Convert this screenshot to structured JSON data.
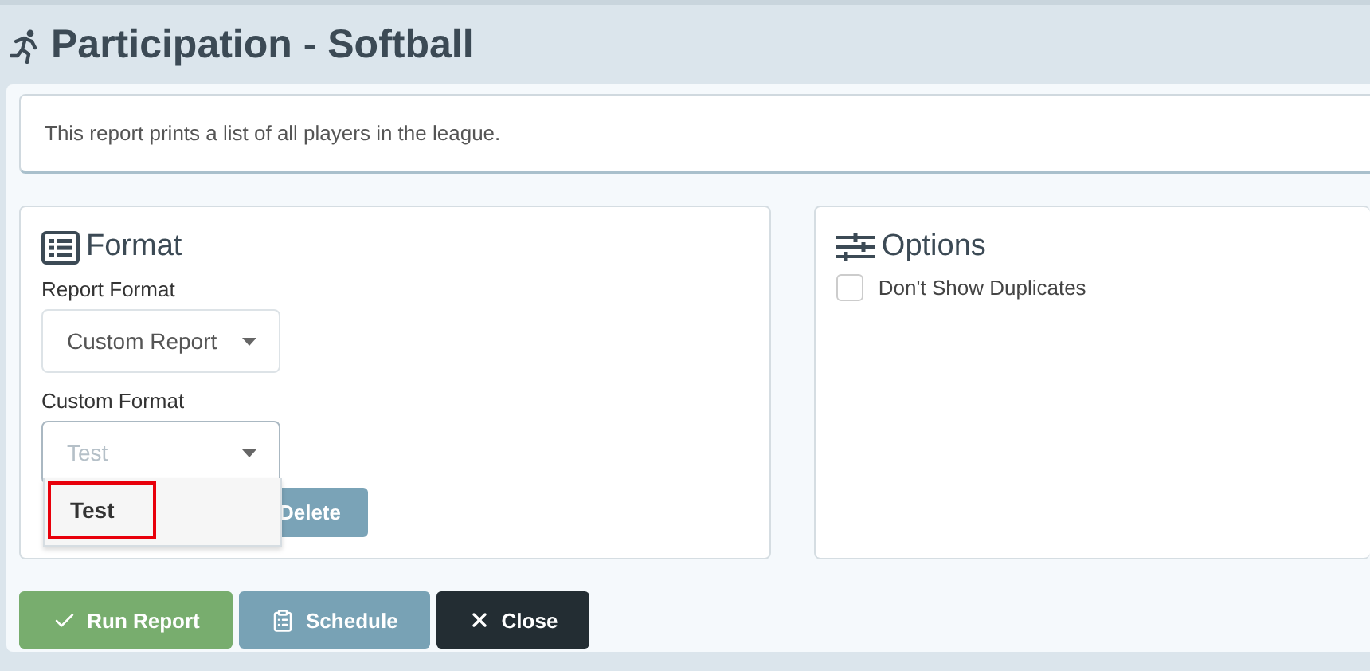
{
  "page": {
    "title": "Participation - Softball"
  },
  "description": "This report prints a list of all players in the league.",
  "format_card": {
    "title": "Format",
    "fields": [
      {
        "label": "Report Format",
        "value": "Custom Report",
        "open": false
      },
      {
        "label": "Custom Format",
        "placeholder": "Test",
        "open": true,
        "options": [
          {
            "label": "Test",
            "highlighted": true
          }
        ]
      }
    ],
    "buttons": [
      {
        "label": "Delete"
      }
    ]
  },
  "options_card": {
    "title": "Options",
    "checkboxes": [
      {
        "label": "Don't Show Duplicates",
        "checked": false
      }
    ]
  },
  "actions": [
    {
      "kind": "run",
      "label": "Run Report"
    },
    {
      "kind": "schedule",
      "label": "Schedule"
    },
    {
      "kind": "close",
      "label": "Close"
    }
  ]
}
